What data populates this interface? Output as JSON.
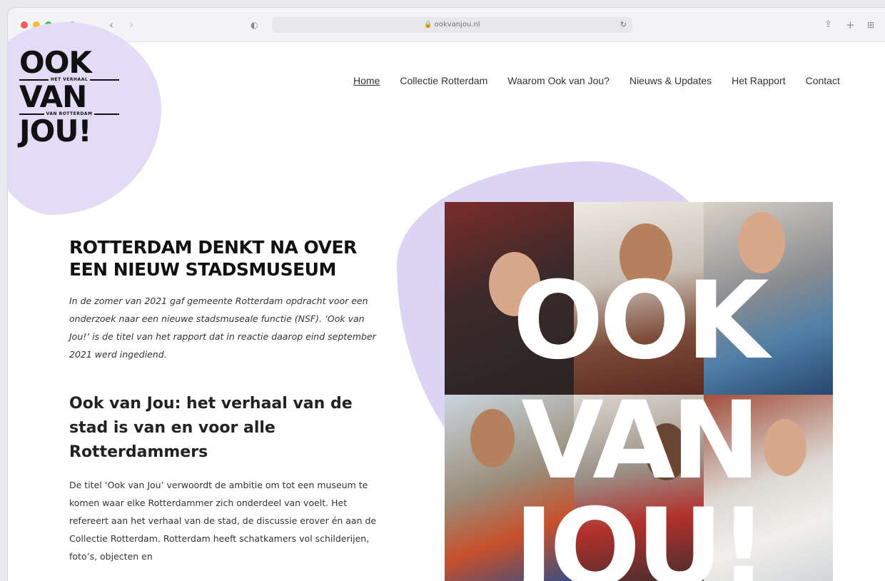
{
  "browser": {
    "url": "ookvanjou.nl",
    "icons": {
      "sidebar": "sidebar-icon",
      "back": "chevron-left-icon",
      "forward": "chevron-right-icon",
      "privacy": "shield-icon",
      "tab": "tab-icon",
      "lock": "lock-icon",
      "reload": "reload-icon",
      "share": "share-icon",
      "newtab": "plus-icon",
      "tabs": "grid-icon"
    }
  },
  "logo": {
    "line1": "OOK",
    "tag1": "HET VERHAAL",
    "line2": "VAN",
    "tag2": "VAN ROTTERDAM",
    "line3": "JOU!"
  },
  "nav": {
    "items": [
      {
        "label": "Home",
        "active": true
      },
      {
        "label": "Collectie Rotterdam"
      },
      {
        "label": "Waarom Ook van Jou?"
      },
      {
        "label": "Nieuws & Updates"
      },
      {
        "label": "Het Rapport"
      },
      {
        "label": "Contact"
      }
    ]
  },
  "main": {
    "heading": "ROTTERDAM DENKT NA OVER EEN NIEUW STADSMUSEUM",
    "intro": "In de zomer van 2021 gaf gemeente Rotterdam opdracht voor een onderzoek naar een nieuwe stadsmuseale functie (NSF). ‘Ook van Jou!’ is de titel van het rapport dat in reactie daarop eind september 2021 werd ingediend.",
    "subheading": "Ook van Jou: het verhaal van de stad is van en voor alle Rotterdammers",
    "body": "De titel ‘Ook van Jou’ verwoordt de ambitie om tot een museum te komen waar elke Rotterdammer zich onderdeel van voelt.  Het refereert aan het verhaal van de stad, de discussie erover én aan de Collectie Rotterdam. Rotterdam heeft schatkamers vol schilderijen, foto’s, objecten en"
  },
  "hero": {
    "word1": "OOK",
    "word2": "VAN",
    "word3": "JOU!"
  },
  "colors": {
    "accent_lilac": "#e3dcf6",
    "text": "#111111"
  }
}
